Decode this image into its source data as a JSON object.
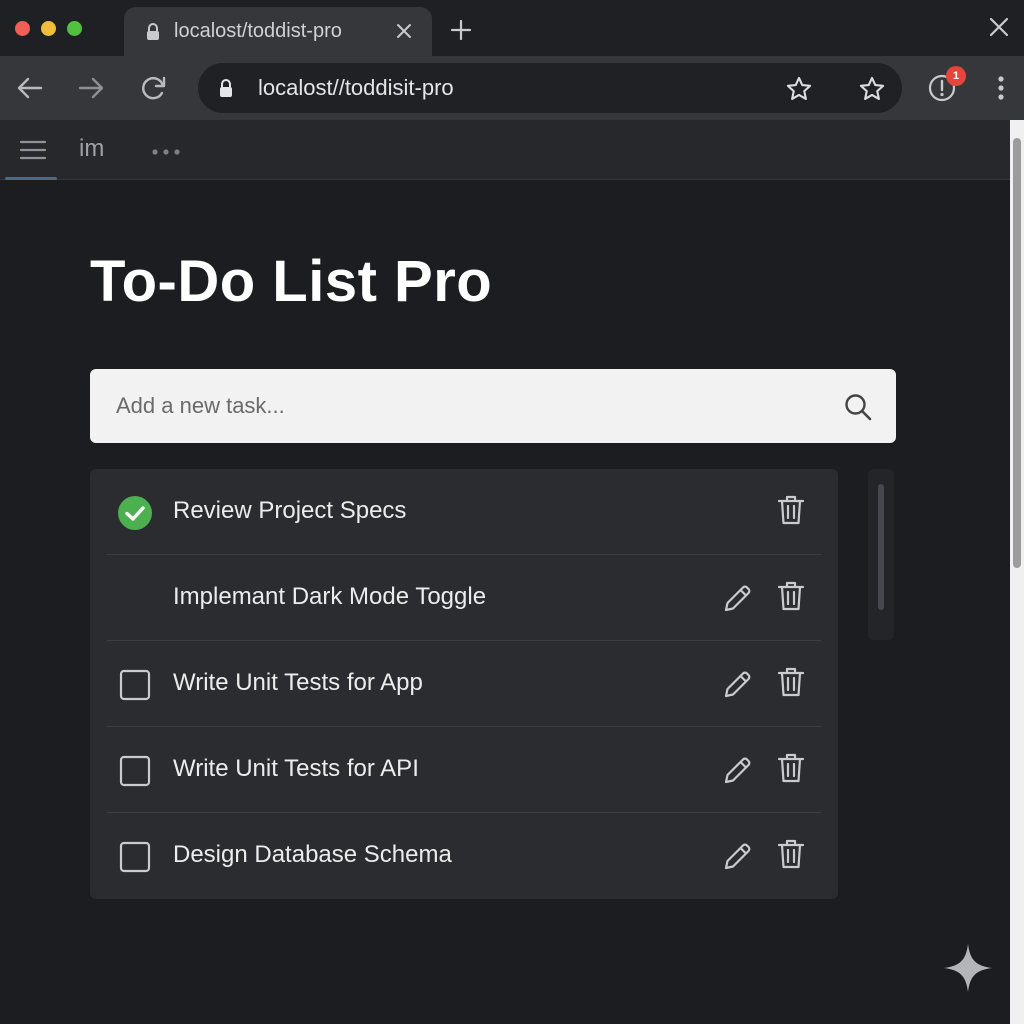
{
  "browser": {
    "tab": {
      "title": "localost/toddist-pro"
    },
    "address_bar": {
      "url": "localost//toddisit-pro"
    },
    "extension_badge": "1"
  },
  "app_header": {
    "label": "im"
  },
  "page": {
    "title": "To-Do List Pro"
  },
  "task_input": {
    "value": "",
    "placeholder": "Add a new task..."
  },
  "tasks": [
    {
      "label": "Review Project Specs",
      "status": "completed",
      "editable": false
    },
    {
      "label": "Implemant Dark Mode Toggle",
      "status": "in-progress",
      "editable": true
    },
    {
      "label": "Write Unit Tests for App",
      "status": "pending",
      "editable": true
    },
    {
      "label": "Write Unit Tests for API",
      "status": "pending",
      "editable": true
    },
    {
      "label": "Design Database Schema",
      "status": "pending",
      "editable": true
    }
  ],
  "icons": {
    "completed_check": "check-circle-icon",
    "pending_check": "checkbox-icon",
    "edit": "pencil-icon",
    "delete": "trash-icon",
    "search": "search-icon"
  },
  "colors": {
    "background": "#1b1d20",
    "accent_green": "#4cb050",
    "badge_red": "#e5453b",
    "input_background": "#f2f2f2"
  }
}
